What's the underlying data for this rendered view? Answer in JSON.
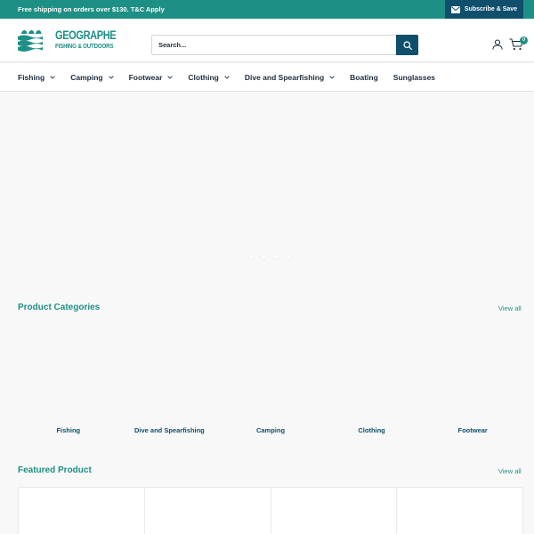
{
  "announcement": {
    "text": "Free shipping on orders over $130. T&C Apply",
    "subscribe_label": "Subscribe & Save"
  },
  "header": {
    "logo": {
      "line1": "GEOGRAPHE",
      "line2": "FISHING & OUTDOORS"
    },
    "search": {
      "placeholder": "Search..."
    },
    "cart_count": "0"
  },
  "nav": {
    "items": [
      {
        "label": "Fishing",
        "has_dropdown": true
      },
      {
        "label": "Camping",
        "has_dropdown": true
      },
      {
        "label": "Footwear",
        "has_dropdown": true
      },
      {
        "label": "Clothing",
        "has_dropdown": true
      },
      {
        "label": "Dive and Spearfishing",
        "has_dropdown": true
      },
      {
        "label": "Boating",
        "has_dropdown": false
      },
      {
        "label": "Sunglasses",
        "has_dropdown": false
      }
    ]
  },
  "hero": {
    "slide_count": 4
  },
  "categories": {
    "title": "Product Categories",
    "view_all": "View all",
    "items": [
      "Fishing",
      "Dive and Spearfishing",
      "Camping",
      "Clothing",
      "Footwear"
    ]
  },
  "featured": {
    "title": "Featured Product",
    "view_all": "View all"
  },
  "colors": {
    "brand_teal": "#1e8f84",
    "dark_blue": "#0f4f6b",
    "text": "#1e2d3b"
  }
}
